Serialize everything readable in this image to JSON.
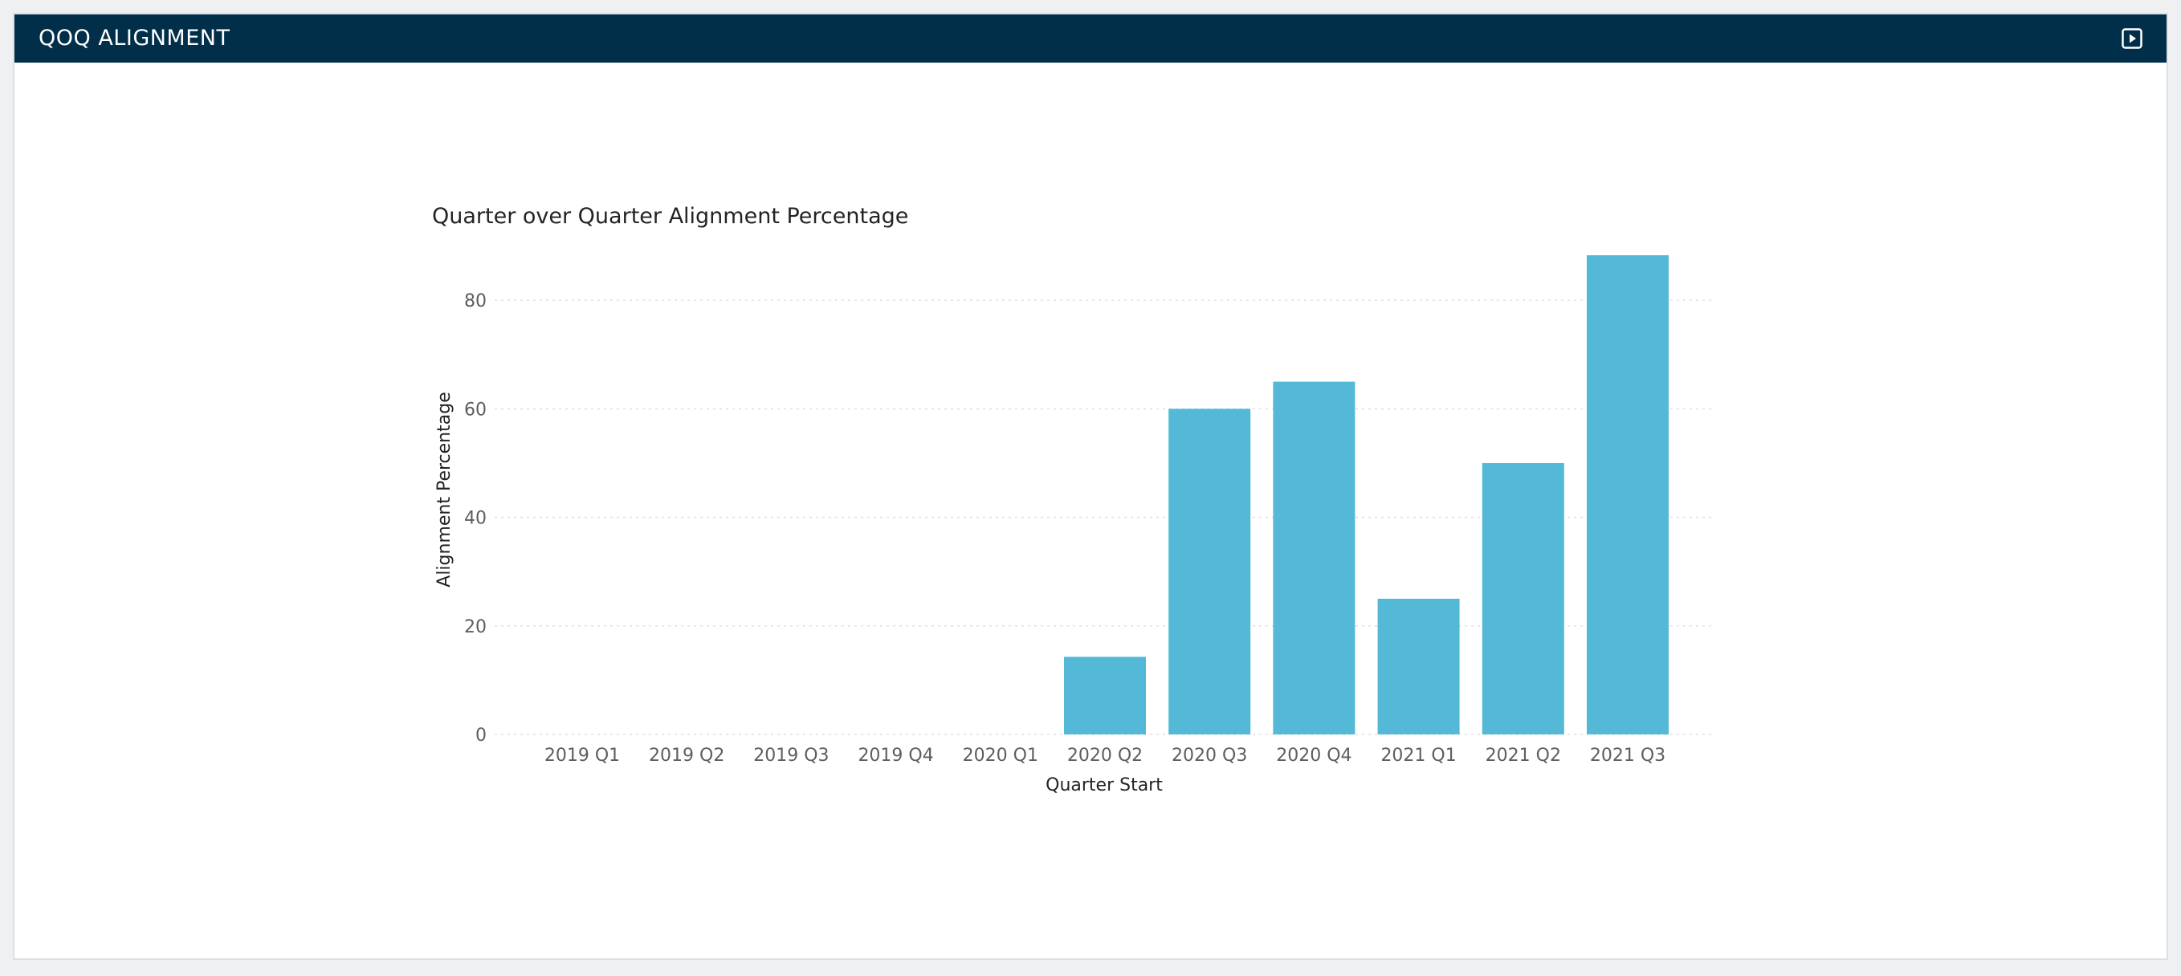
{
  "header": {
    "title": "QOQ ALIGNMENT",
    "expand_icon": "play-square-icon"
  },
  "colors": {
    "header_bg": "#012f4a",
    "bar": "#53b9d6",
    "text": "#252423",
    "tick_text": "#605e5c",
    "grid": "#e1dfdd"
  },
  "chart_data": {
    "type": "bar",
    "title": "Quarter over Quarter Alignment Percentage",
    "xlabel": "Quarter Start",
    "ylabel": "Alignment Percentage",
    "categories": [
      "2019 Q1",
      "2019 Q2",
      "2019 Q3",
      "2019 Q4",
      "2020 Q1",
      "2020 Q2",
      "2020 Q3",
      "2020 Q4",
      "2021 Q1",
      "2021 Q2",
      "2021 Q3"
    ],
    "values": [
      0,
      0,
      0,
      0,
      0,
      14.3,
      60,
      65,
      25,
      50,
      88.3
    ],
    "ylim": [
      0,
      88.3
    ],
    "yticks": [
      0,
      20,
      40,
      60,
      80
    ],
    "grid": true,
    "legend": "none"
  }
}
